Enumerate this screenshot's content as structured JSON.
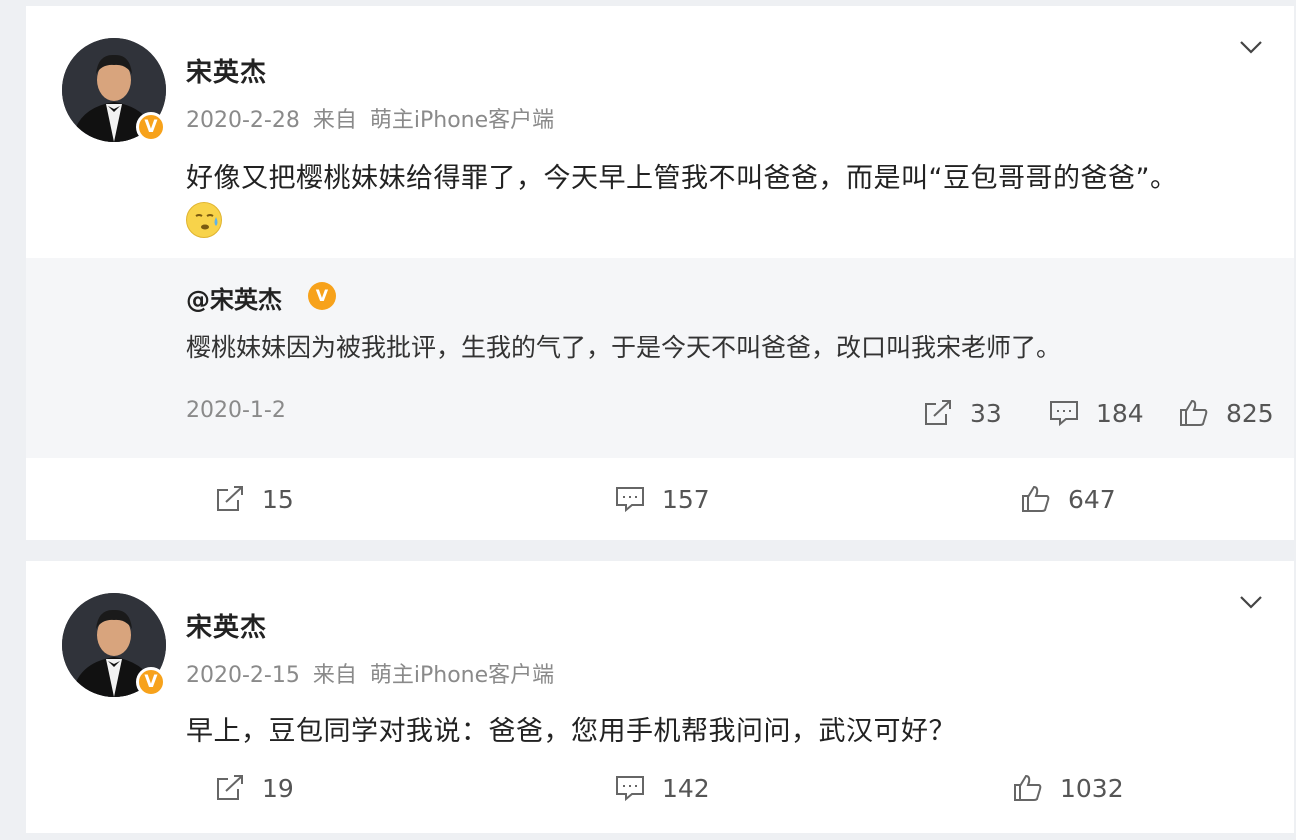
{
  "posts": [
    {
      "username": "宋英杰",
      "date": "2020-2-28",
      "source_prefix": "来自",
      "source": "萌主iPhone客户端",
      "text": "好像又把樱桃妹妹给得罪了，今天早上管我不叫爸爸，而是叫“豆包哥哥的爸爸”。",
      "emoji": "sweat-face-emoji",
      "verified_badge": "V",
      "repost": {
        "mention": "@宋英杰",
        "verified_badge": "V",
        "text": "樱桃妹妹因为被我批评，生我的气了，于是今天不叫爸爸，改口叫我宋老师了。",
        "date": "2020-1-2",
        "shares": "33",
        "comments": "184",
        "likes": "825"
      },
      "shares": "15",
      "comments": "157",
      "likes": "647"
    },
    {
      "username": "宋英杰",
      "date": "2020-2-15",
      "source_prefix": "来自",
      "source": "萌主iPhone客户端",
      "text": "早上，豆包同学对我说：爸爸，您用手机帮我问问，武汉可好？",
      "verified_badge": "V",
      "shares": "19",
      "comments": "142",
      "likes": "1032"
    }
  ],
  "colors": {
    "page_bg": "#eef0f3",
    "card_bg": "#ffffff",
    "repost_bg": "#f5f6f8",
    "verified_orange": "#f7a21b",
    "meta_gray": "#8a8a8a"
  }
}
